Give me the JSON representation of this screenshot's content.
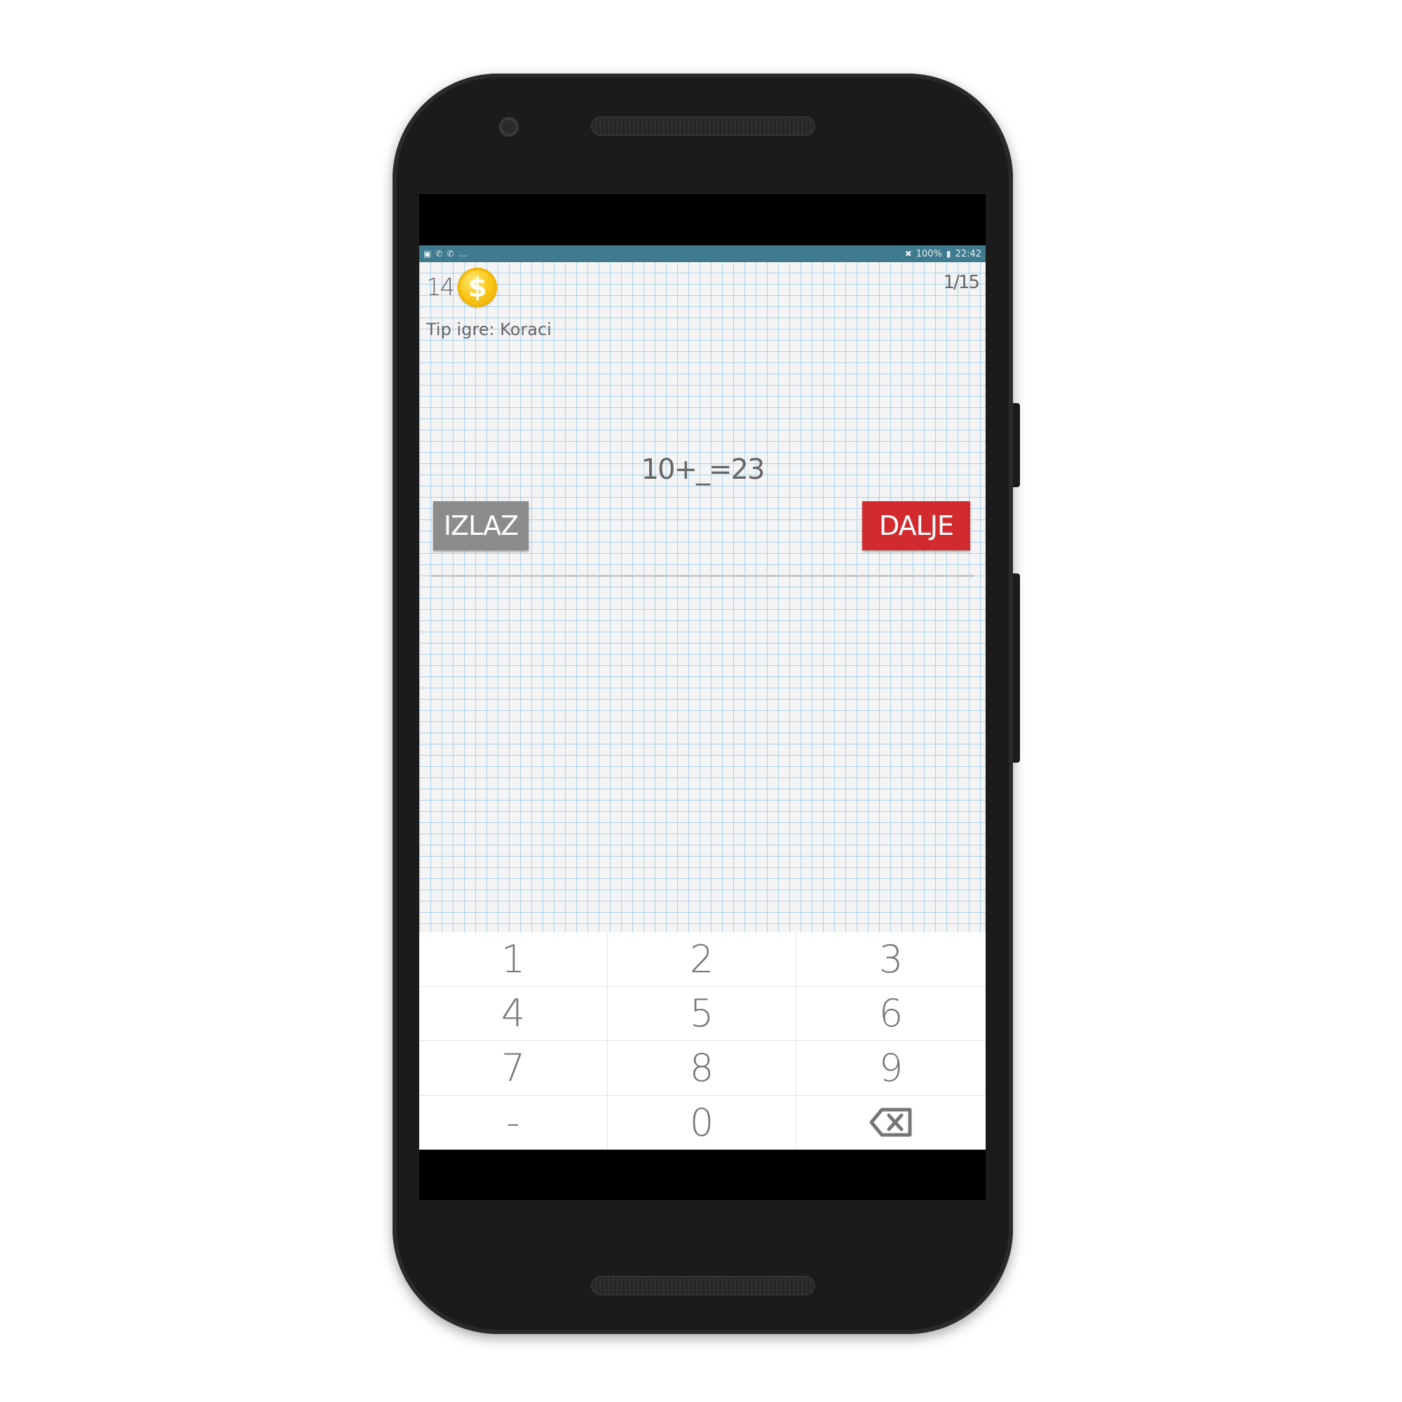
{
  "status_bar": {
    "left_icons": [
      "image-icon",
      "whatsapp-icon",
      "whatsapp-icon"
    ],
    "overflow": "...",
    "battery": "100%",
    "time": "22:42"
  },
  "header": {
    "coins": "14",
    "coin_symbol": "$",
    "progress": "1/15",
    "game_type": "Tip igre: Koraci"
  },
  "question": {
    "equation": "10+_=23"
  },
  "buttons": {
    "exit_label": "IZLAZ",
    "next_label": "DALJE"
  },
  "keypad": {
    "keys": [
      "1",
      "2",
      "3",
      "4",
      "5",
      "6",
      "7",
      "8",
      "9",
      "-",
      "0"
    ],
    "backspace_icon": "backspace-icon"
  },
  "colors": {
    "status_bar": "#3f7a8e",
    "next_button": "#d22b2f",
    "exit_button": "#8c8c8c",
    "grid_line": "#96c8eb"
  }
}
